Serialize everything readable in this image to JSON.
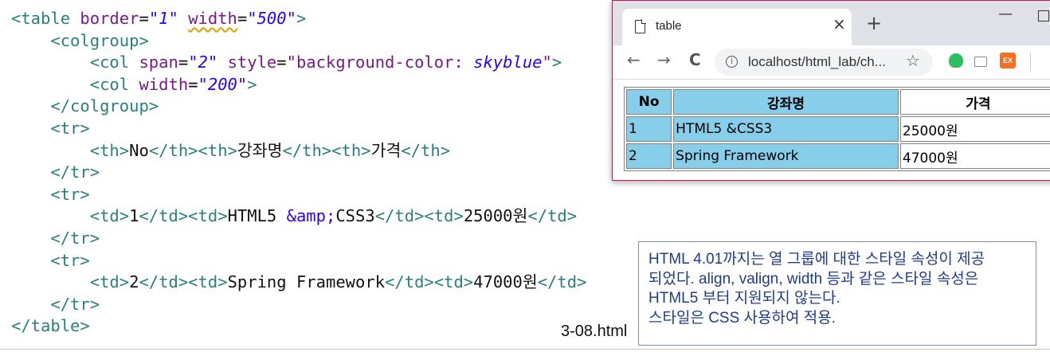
{
  "code": {
    "lines": [
      [
        [
          "tg",
          "<table "
        ],
        [
          "at",
          "border"
        ],
        [
          "txt",
          "="
        ],
        [
          "vl",
          "\"1\""
        ],
        [
          "txt",
          " "
        ],
        [
          "at",
          "width"
        ],
        [
          "txt",
          "="
        ],
        [
          "vl",
          "\"500\""
        ],
        [
          "tg",
          ">"
        ]
      ],
      [
        [
          "txt",
          "    "
        ],
        [
          "tg",
          "<colgroup>"
        ]
      ],
      [
        [
          "txt",
          "        "
        ],
        [
          "tg",
          "<col "
        ],
        [
          "at",
          "span"
        ],
        [
          "txt",
          "="
        ],
        [
          "vl",
          "\"2\""
        ],
        [
          "txt",
          " "
        ],
        [
          "at",
          "style"
        ],
        [
          "txt",
          "="
        ],
        [
          "at",
          "\"background-color: "
        ],
        [
          "vl",
          "skyblue"
        ],
        [
          "at",
          "\""
        ],
        [
          "tg",
          ">"
        ]
      ],
      [
        [
          "txt",
          "        "
        ],
        [
          "tg",
          "<col "
        ],
        [
          "at",
          "width"
        ],
        [
          "txt",
          "="
        ],
        [
          "vl",
          "\"200\""
        ],
        [
          "tg",
          ">"
        ]
      ],
      [
        [
          "txt",
          "    "
        ],
        [
          "tg",
          "</colgroup>"
        ]
      ],
      [
        [
          "txt",
          "    "
        ],
        [
          "tg",
          "<tr>"
        ]
      ],
      [
        [
          "txt",
          "        "
        ],
        [
          "tg",
          "<th>"
        ],
        [
          "txt",
          "No"
        ],
        [
          "tg",
          "</th><th>"
        ],
        [
          "txt",
          "강좌명"
        ],
        [
          "tg",
          "</th><th>"
        ],
        [
          "txt",
          "가격"
        ],
        [
          "tg",
          "</th>"
        ]
      ],
      [
        [
          "txt",
          "    "
        ],
        [
          "tg",
          "</tr>"
        ]
      ],
      [
        [
          "txt",
          "    "
        ],
        [
          "tg",
          "<tr>"
        ]
      ],
      [
        [
          "txt",
          "        "
        ],
        [
          "tg",
          "<td>"
        ],
        [
          "txt",
          "1"
        ],
        [
          "tg",
          "</td><td>"
        ],
        [
          "txt",
          "HTML5 "
        ],
        [
          "ent",
          "&amp;"
        ],
        [
          "txt",
          "CSS3"
        ],
        [
          "tg",
          "</td><td>"
        ],
        [
          "txt",
          "25000원"
        ],
        [
          "tg",
          "</td>"
        ]
      ],
      [
        [
          "txt",
          "    "
        ],
        [
          "tg",
          "</tr>"
        ]
      ],
      [
        [
          "txt",
          "    "
        ],
        [
          "tg",
          "<tr>"
        ]
      ],
      [
        [
          "txt",
          "        "
        ],
        [
          "tg",
          "<td>"
        ],
        [
          "txt",
          "2"
        ],
        [
          "tg",
          "</td><td>"
        ],
        [
          "txt",
          "Spring Framework"
        ],
        [
          "tg",
          "</td><td>"
        ],
        [
          "txt",
          "47000원"
        ],
        [
          "tg",
          "</td>"
        ]
      ],
      [
        [
          "txt",
          "    "
        ],
        [
          "tg",
          "</tr>"
        ]
      ],
      [
        [
          "tg",
          "</table>"
        ]
      ]
    ]
  },
  "filename": "3-08.html",
  "note": {
    "lines": [
      "HTML 4.01까지는 열 그룹에 대한 스타일 속성이 제공",
      "되었다. align, valign, width 등과 같은 스타일 속성은",
      "HTML5 부터 지원되지 않는다.",
      "스타일은 CSS 사용하여 적용."
    ]
  },
  "browser": {
    "tab_title": "table",
    "tab_close": "×",
    "new_tab": "+",
    "minimize": "—",
    "back": "←",
    "forward": "→",
    "reload": "C",
    "info": "i",
    "url": "localhost/html_lab/ch...",
    "star": "☆",
    "ext_label": "EX",
    "table": {
      "headers": [
        "No",
        "강좌명",
        "가격"
      ],
      "rows": [
        [
          "1",
          "HTML5 &CSS3",
          "25000원"
        ],
        [
          "2",
          "Spring Framework",
          "47000원"
        ]
      ]
    }
  },
  "colors": {
    "skyblue": "#87ceeb",
    "browser_border": "#c2185b",
    "note_text": "#1d3c8a"
  }
}
